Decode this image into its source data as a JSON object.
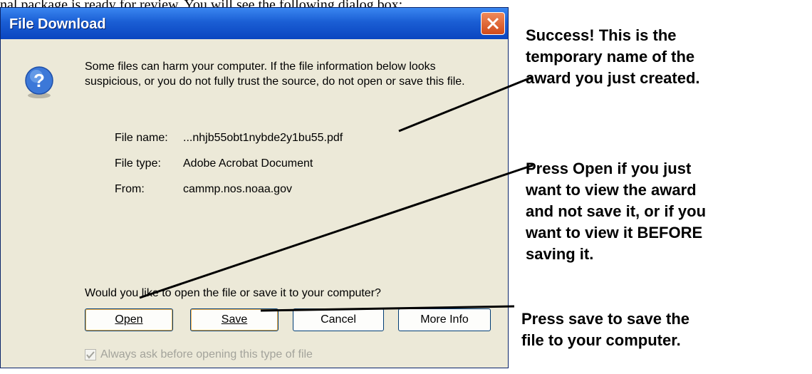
{
  "top_fragment": "nal package is ready for review. You will see the following dialog box:",
  "dialog": {
    "title": "File Download",
    "warning": "Some files can harm your computer. If the file information below looks suspicious, or you do not fully trust the source, do not open or save this file.",
    "file_name_label": "File name:",
    "file_name_value": "...nhjb55obt1nybde2y1bu55.pdf",
    "file_type_label": "File type:",
    "file_type_value": "Adobe Acrobat Document",
    "from_label": "From:",
    "from_value": "cammp.nos.noaa.gov",
    "question": "Would you like to open the file or save it to your computer?",
    "buttons": {
      "open": "Open",
      "save": "Save",
      "cancel": "Cancel",
      "more_info": "More Info"
    },
    "checkbox_label": "Always ask before opening this type of file",
    "checkbox_checked": true
  },
  "annotations": {
    "success": [
      "Success!  This is the",
      "temporary name of the",
      "award you just created."
    ],
    "open": [
      "Press Open if you just",
      "want to view the award",
      "and not save it,  or if you",
      "want to view it BEFORE",
      "saving it."
    ],
    "save": [
      "Press save to save the",
      "file to your computer."
    ]
  },
  "colors": {
    "title_bar": "#0a46c0",
    "dialog_bg": "#ece9d8",
    "close_button": "#d04a1a"
  }
}
